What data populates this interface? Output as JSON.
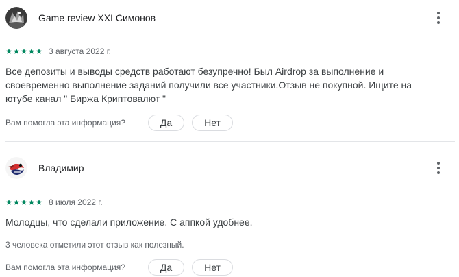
{
  "reviews": [
    {
      "author": "Game review XXI Симонов",
      "rating": 5,
      "rating_max": 5,
      "star_color": "#01875f",
      "date": "3 августа 2022 г.",
      "text": "Все депозиты и выводы средств работают безупречно! Был Airdrop за выполнение и своевременно выполнение заданий получили все участники.Отзыв не покупной. Ищите на ютубе канал \" Биржа Криптовалют \"",
      "helpful_question": "Вам помогла эта информация?",
      "yes_label": "Да",
      "no_label": "Нет"
    },
    {
      "author": "Владимир",
      "rating": 5,
      "rating_max": 5,
      "star_color": "#01875f",
      "date": "8 июля 2022 г.",
      "text": "Молодцы, что сделали приложение. С аппкой удобнее.",
      "helpful_count_text": "3 человека отметили этот отзыв как полезный.",
      "helpful_question": "Вам помогла эта информация?",
      "yes_label": "Да",
      "no_label": "Нет"
    }
  ],
  "icons": {
    "more": "more-vert-icon",
    "star": "star-icon"
  },
  "colors": {
    "star": "#01875f",
    "text": "#3c4043",
    "secondary": "#5f6368",
    "divider": "#e3e5e8",
    "button_border": "#dadce0"
  }
}
